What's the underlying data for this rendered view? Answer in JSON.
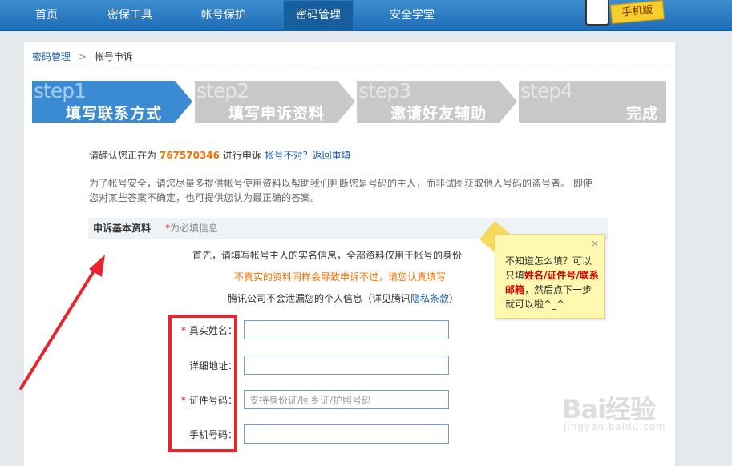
{
  "nav": {
    "items": [
      "首页",
      "密保工具",
      "帐号保护",
      "密码管理",
      "安全学堂"
    ],
    "active_index": 3,
    "mobile_badge": "手机版"
  },
  "breadcrumb": {
    "parent": "密码管理",
    "separator": ">",
    "current": "帐号申诉"
  },
  "steps": [
    {
      "num": "step1",
      "label": "填写联系方式",
      "active": true
    },
    {
      "num": "step2",
      "label": "填写申诉资料",
      "active": false
    },
    {
      "num": "step3",
      "label": "邀请好友辅助",
      "active": false
    },
    {
      "num": "step4",
      "label": "完成",
      "active": false
    }
  ],
  "confirm": {
    "prefix": "请确认您正在为",
    "qq": "767570346",
    "suffix": "进行申诉",
    "link": "帐号不对？返回重填"
  },
  "notice": "为了帐号安全，请您尽量多提供帐号使用资料以帮助我们判断您是号码的主人，而非试图获取他人号码的盗号者。 即使您对某些答案不确定，也可提供您认为最正确的答案。",
  "section": {
    "title": "申诉基本资料",
    "required_star": "*",
    "required_text": "为必填信息"
  },
  "info": {
    "line1": "首先，请填写帐号主人的实名信息，全部资料仅用于帐号的身份",
    "line2": "不真实的资料同样会导致申诉不过，请您认真填写",
    "line3_prefix": "腾讯公司不会泄漏您的个人信息（详见腾讯",
    "line3_link": "隐私条款",
    "line3_suffix": "）"
  },
  "tooltip": {
    "close": "×",
    "text_prefix": "不知道怎么填？可以只填",
    "text_bold": "姓名/证件号/联系邮箱",
    "text_suffix": "，然后点下一步就可以啦^_^"
  },
  "form": {
    "fields": [
      {
        "label": "真实姓名：",
        "required": true,
        "placeholder": ""
      },
      {
        "label": "详细地址：",
        "required": false,
        "placeholder": ""
      },
      {
        "label": "证件号码：",
        "required": true,
        "placeholder": "支持身份证/回乡证/护照号码"
      },
      {
        "label": "手机号码：",
        "required": false,
        "placeholder": ""
      }
    ]
  },
  "watermark": {
    "logo": "Bai经验",
    "url": "jingyan.baidu.com"
  },
  "colors": {
    "nav_blue": "#1e6db7",
    "step_active": "#3a8bd2",
    "step_inactive": "#c8c8c8",
    "qq_orange": "#f07200",
    "link_blue": "#1a5ca8",
    "annotation_red": "#e8242e"
  }
}
